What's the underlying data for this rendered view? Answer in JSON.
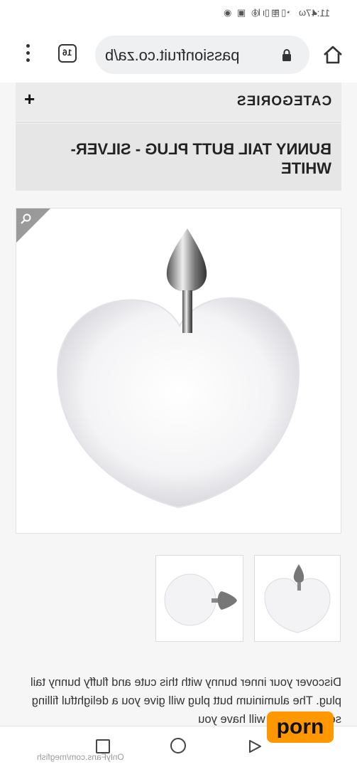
{
  "status_bar": {
    "time": "11:47",
    "left_icons": "▯◫▯ ◎ ▣ ◉",
    "right_icons": "◂ ω ◔ ≋ ıll"
  },
  "browser": {
    "url": "passionfruit.co.za/b",
    "tab_count": "16"
  },
  "page": {
    "categories_label": "CATEGORIES",
    "categories_toggle": "+",
    "product_title": "BUNNY TAIL BUTT PLUG - SILVER-WHITE",
    "description": "Discover your inner bunny with this cute and fluffy bunny tail plug. The aluminium butt plug will give you a delightful filling sensation that will have you"
  },
  "watermark": {
    "badge": "porn",
    "url": "OnlyFans.com/megfish"
  },
  "colors": {
    "page_bg": "#f6f6f6",
    "title_box": "#e6e6e6",
    "badge": "#ff9800"
  }
}
